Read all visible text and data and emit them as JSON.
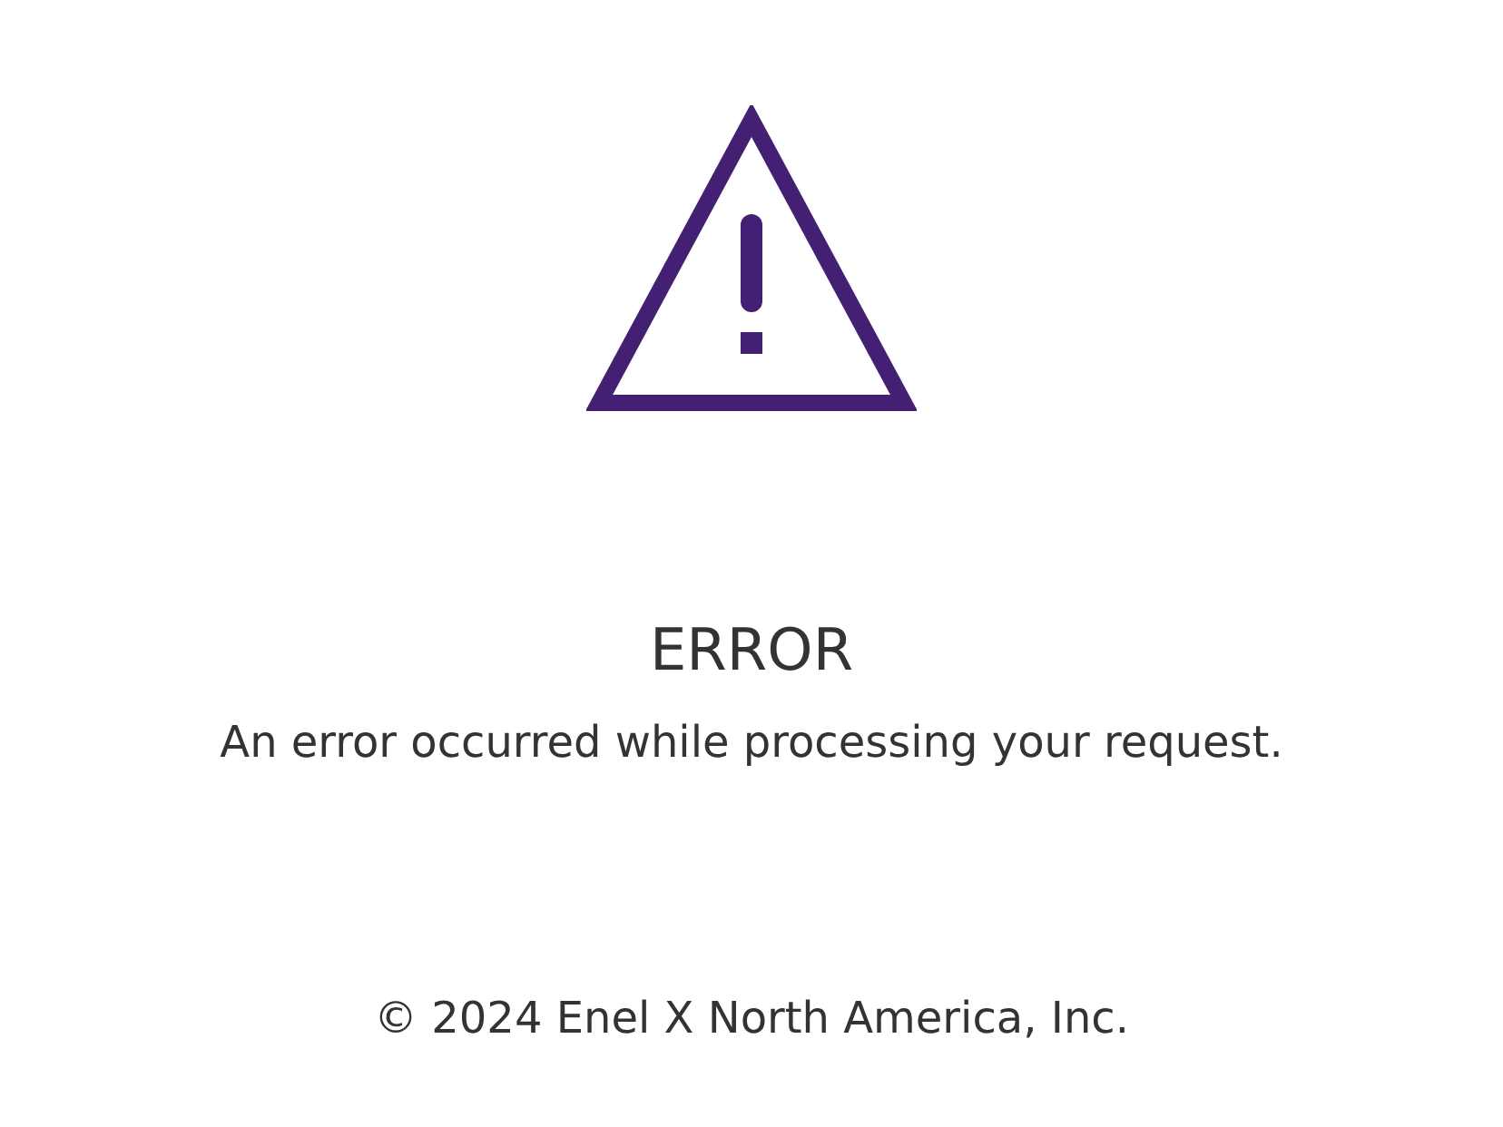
{
  "title": "ERROR",
  "message": "An error occurred while processing your request.",
  "footer": "© 2024 Enel X North America, Inc."
}
